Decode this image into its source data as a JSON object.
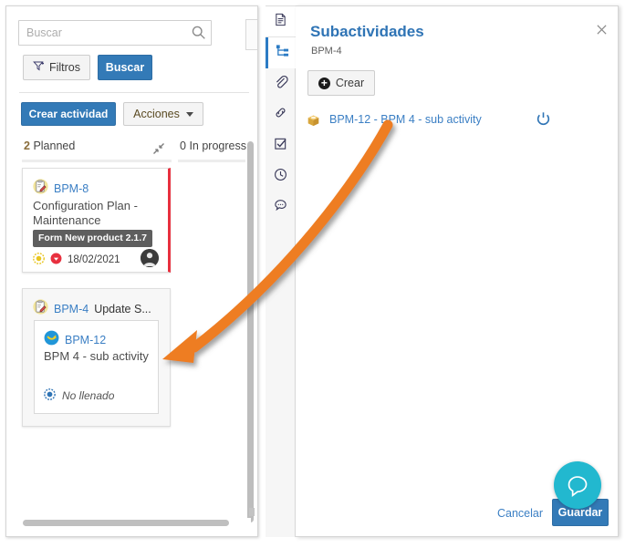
{
  "left_pane": {
    "search": {
      "placeholder": "Buscar",
      "value": "",
      "icon": "search-icon"
    },
    "filters_button": {
      "label": "Filtros",
      "icon": "funnel-plus-icon"
    },
    "search_button": {
      "label": "Buscar"
    },
    "create_activity_button": {
      "label": "Crear actividad"
    },
    "actions_button": {
      "label": "Acciones",
      "icon": "chevron-down-icon"
    },
    "columns": [
      {
        "count": "2",
        "name": "Planned",
        "header": "2 Planned",
        "collapse_icon": "collapse-icon"
      },
      {
        "count": "0",
        "name": "In progress",
        "header": "0 In progress"
      }
    ],
    "cards": [
      {
        "id": "BPM-8",
        "id_suffix": "",
        "title": "Configuration Plan - Maintenance",
        "tag": "Form New product 2.1.7",
        "due_date": "18/02/2021",
        "status_icon": "target-icon",
        "priority_icon": "arrow-down-circle-icon",
        "type_icon": "clipboard-pencil-icon",
        "avatar": "user-avatar",
        "accent_color": "#e8303f"
      },
      {
        "id": "BPM-4",
        "id_suffix": "Update S...",
        "type_icon": "clipboard-pencil-icon",
        "subcard": {
          "id": "BPM-12",
          "title": "BPM 4 - sub activity",
          "type_icon": "arrow-circle-icon",
          "state_label": "No llenado",
          "state_icon": "radio-filled-icon"
        }
      }
    ]
  },
  "rail": {
    "items": [
      {
        "icon": "document-icon",
        "active": false
      },
      {
        "icon": "hierarchy-tree-icon",
        "active": true
      },
      {
        "icon": "paperclip-icon",
        "active": false
      },
      {
        "icon": "link-icon",
        "active": false
      },
      {
        "icon": "checkbox-checked-icon",
        "active": false
      },
      {
        "icon": "clock-icon",
        "active": false
      },
      {
        "icon": "comment-icon",
        "active": false
      }
    ]
  },
  "right_pane": {
    "title": "Subactividades",
    "subtitle": "BPM-4",
    "close_icon": "close-icon",
    "create_button": {
      "label": "Crear",
      "icon": "plus-circle-icon"
    },
    "subactivity_rows": [
      {
        "label": "BPM-12 - BPM 4 - sub activity",
        "icon": "package-box-icon",
        "action_icon": "power-icon"
      }
    ],
    "cancel_button": {
      "label": "Cancelar"
    },
    "save_button": {
      "label": "Guardar"
    },
    "chat_fab": {
      "icon": "chat-bubble-icon"
    }
  },
  "colors": {
    "primary_blue": "#337ab7",
    "link_blue": "#3b7fc4",
    "title_blue": "#2f74b5",
    "accent_red": "#e8303f",
    "tag_gray": "#5e5e5e",
    "annotation_orange": "#ee7d22",
    "chat_teal": "#22b8cf",
    "icon_gold": "#e0b24d"
  },
  "annotation": {
    "type": "curved-arrow",
    "color": "#ee7d22",
    "from": "subactivity row BPM-12 in right panel",
    "to": "BPM-12 sub activity card in left board"
  }
}
